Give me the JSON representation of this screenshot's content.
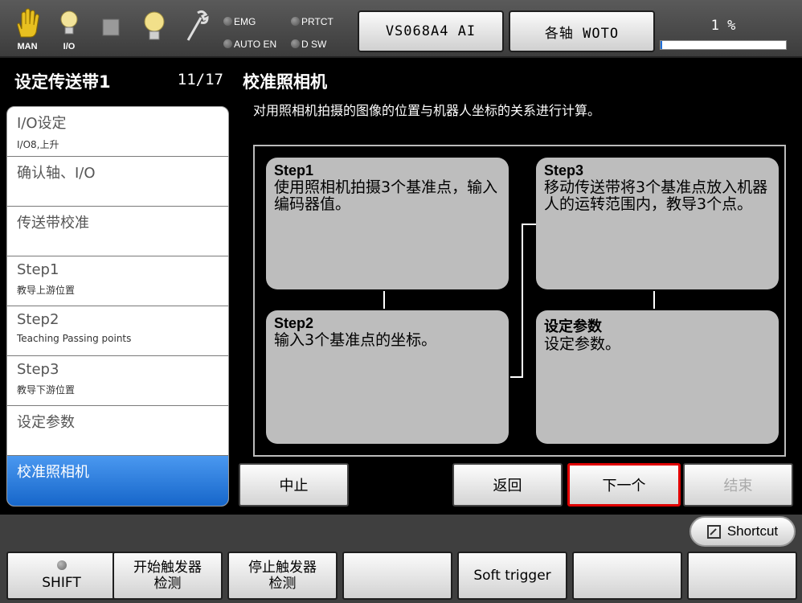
{
  "topbar": {
    "mode_label": "MAN",
    "io_label": "I/O",
    "lamps": [
      "EMG",
      "PRTCT",
      "AUTO EN",
      "D SW"
    ],
    "robot_button": "VS068A4 AI",
    "axis_button": "各轴 WOTO",
    "speed_text": "1 %",
    "speed_fraction": 0.01
  },
  "sidebar": {
    "title": "设定传送带1",
    "count": "11/17",
    "items": [
      {
        "label": "I/O设定",
        "sub": "I/O8,上升"
      },
      {
        "label": "确认轴、I/O",
        "sub": ""
      },
      {
        "label": "传送带校准",
        "sub": ""
      },
      {
        "label": "Step1",
        "sub": "教导上游位置"
      },
      {
        "label": "Step2",
        "sub": "Teaching Passing points"
      },
      {
        "label": "Step3",
        "sub": "教导下游位置"
      },
      {
        "label": "设定参数",
        "sub": ""
      },
      {
        "label": "校准照相机",
        "sub": ""
      }
    ]
  },
  "main": {
    "title": "校准照相机",
    "description": "对用照相机拍摄的图像的位置与机器人坐标的关系进行计算。",
    "steps": [
      {
        "head": "Step1",
        "body": "使用照相机拍摄3个基准点，输入编码器值。"
      },
      {
        "head": "Step2",
        "body": "输入3个基准点的坐标。"
      },
      {
        "head": "Step3",
        "body": "移动传送带将3个基准点放入机器人的运转范围内，教导3个点。"
      },
      {
        "head": "设定参数",
        "body": "设定参数。"
      }
    ],
    "buttons": {
      "stop": "中止",
      "back": "返回",
      "next": "下一个",
      "finish": "结束"
    }
  },
  "bottom": {
    "shortcut": "Shortcut",
    "shift": "SHIFT",
    "f1": "开始触发器\n检测",
    "f2": "停止触发器\n检测",
    "soft_trigger": "Soft trigger"
  },
  "colors": {
    "accent": "#1464c8",
    "focus": "#e00000"
  }
}
